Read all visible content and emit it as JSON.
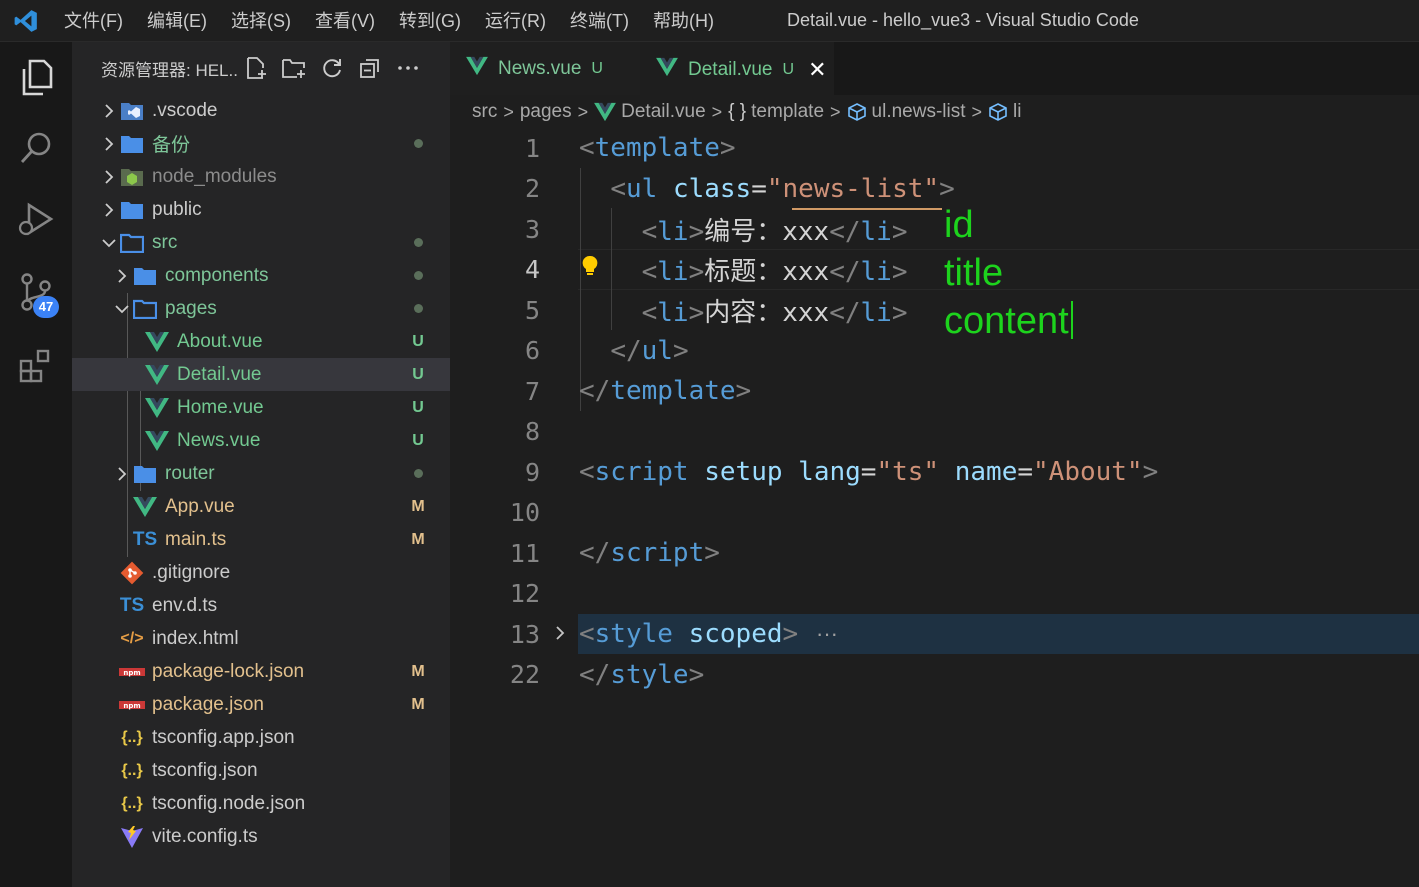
{
  "window": {
    "title": "Detail.vue - hello_vue3 - Visual Studio Code",
    "menu": [
      "文件(F)",
      "编辑(E)",
      "选择(S)",
      "查看(V)",
      "转到(G)",
      "运行(R)",
      "终端(T)",
      "帮助(H)"
    ]
  },
  "activity": {
    "scm_badge": "47"
  },
  "sidebar": {
    "title": "资源管理器: HEL...",
    "items": [
      {
        "name": ".vscode",
        "icon": "vscode-folder-icon",
        "status": ""
      },
      {
        "name": "备份",
        "icon": "folder-icon",
        "status": "dot"
      },
      {
        "name": "node_modules",
        "icon": "node-folder-icon",
        "status": ""
      },
      {
        "name": "public",
        "icon": "folder-icon",
        "status": ""
      },
      {
        "name": "src",
        "icon": "folder-open-icon",
        "status": "dot"
      },
      {
        "name": "components",
        "icon": "folder-icon",
        "status": "dot"
      },
      {
        "name": "pages",
        "icon": "folder-open-icon",
        "status": "dot"
      },
      {
        "name": "About.vue",
        "icon": "vue-icon",
        "status": "U"
      },
      {
        "name": "Detail.vue",
        "icon": "vue-icon",
        "status": "U"
      },
      {
        "name": "Home.vue",
        "icon": "vue-icon",
        "status": "U"
      },
      {
        "name": "News.vue",
        "icon": "vue-icon",
        "status": "U"
      },
      {
        "name": "router",
        "icon": "folder-icon",
        "status": "dot"
      },
      {
        "name": "App.vue",
        "icon": "vue-icon",
        "status": "M"
      },
      {
        "name": "main.ts",
        "icon": "ts-icon",
        "status": "M"
      },
      {
        "name": ".gitignore",
        "icon": "git-icon",
        "status": ""
      },
      {
        "name": "env.d.ts",
        "icon": "ts-icon",
        "status": ""
      },
      {
        "name": "index.html",
        "icon": "html-icon",
        "status": ""
      },
      {
        "name": "package-lock.json",
        "icon": "npm-icon",
        "status": "M"
      },
      {
        "name": "package.json",
        "icon": "npm-icon",
        "status": "M"
      },
      {
        "name": "tsconfig.app.json",
        "icon": "json-icon",
        "status": ""
      },
      {
        "name": "tsconfig.json",
        "icon": "json-icon",
        "status": ""
      },
      {
        "name": "tsconfig.node.json",
        "icon": "json-icon",
        "status": ""
      },
      {
        "name": "vite.config.ts",
        "icon": "vite-icon",
        "status": ""
      }
    ]
  },
  "tabs": [
    {
      "label": "News.vue",
      "status": "U"
    },
    {
      "label": "Detail.vue",
      "status": "U",
      "close": "✕"
    }
  ],
  "breadcrumb": [
    "src",
    "pages",
    "Detail.vue",
    "template",
    "ul.news-list",
    "li"
  ],
  "editor": {
    "line_numbers": [
      "1",
      "2",
      "3",
      "4",
      "5",
      "6",
      "7",
      "8",
      "9",
      "10",
      "11",
      "12",
      "13",
      "22"
    ],
    "annotations": [
      "id",
      "title",
      "content"
    ],
    "fold_ellipsis": "···"
  },
  "colors": {
    "accent": "#0078d4",
    "vue_green": "#41b883",
    "untracked": "#73c991",
    "modified": "#e2c08d",
    "annotation": "#1dd31d"
  }
}
